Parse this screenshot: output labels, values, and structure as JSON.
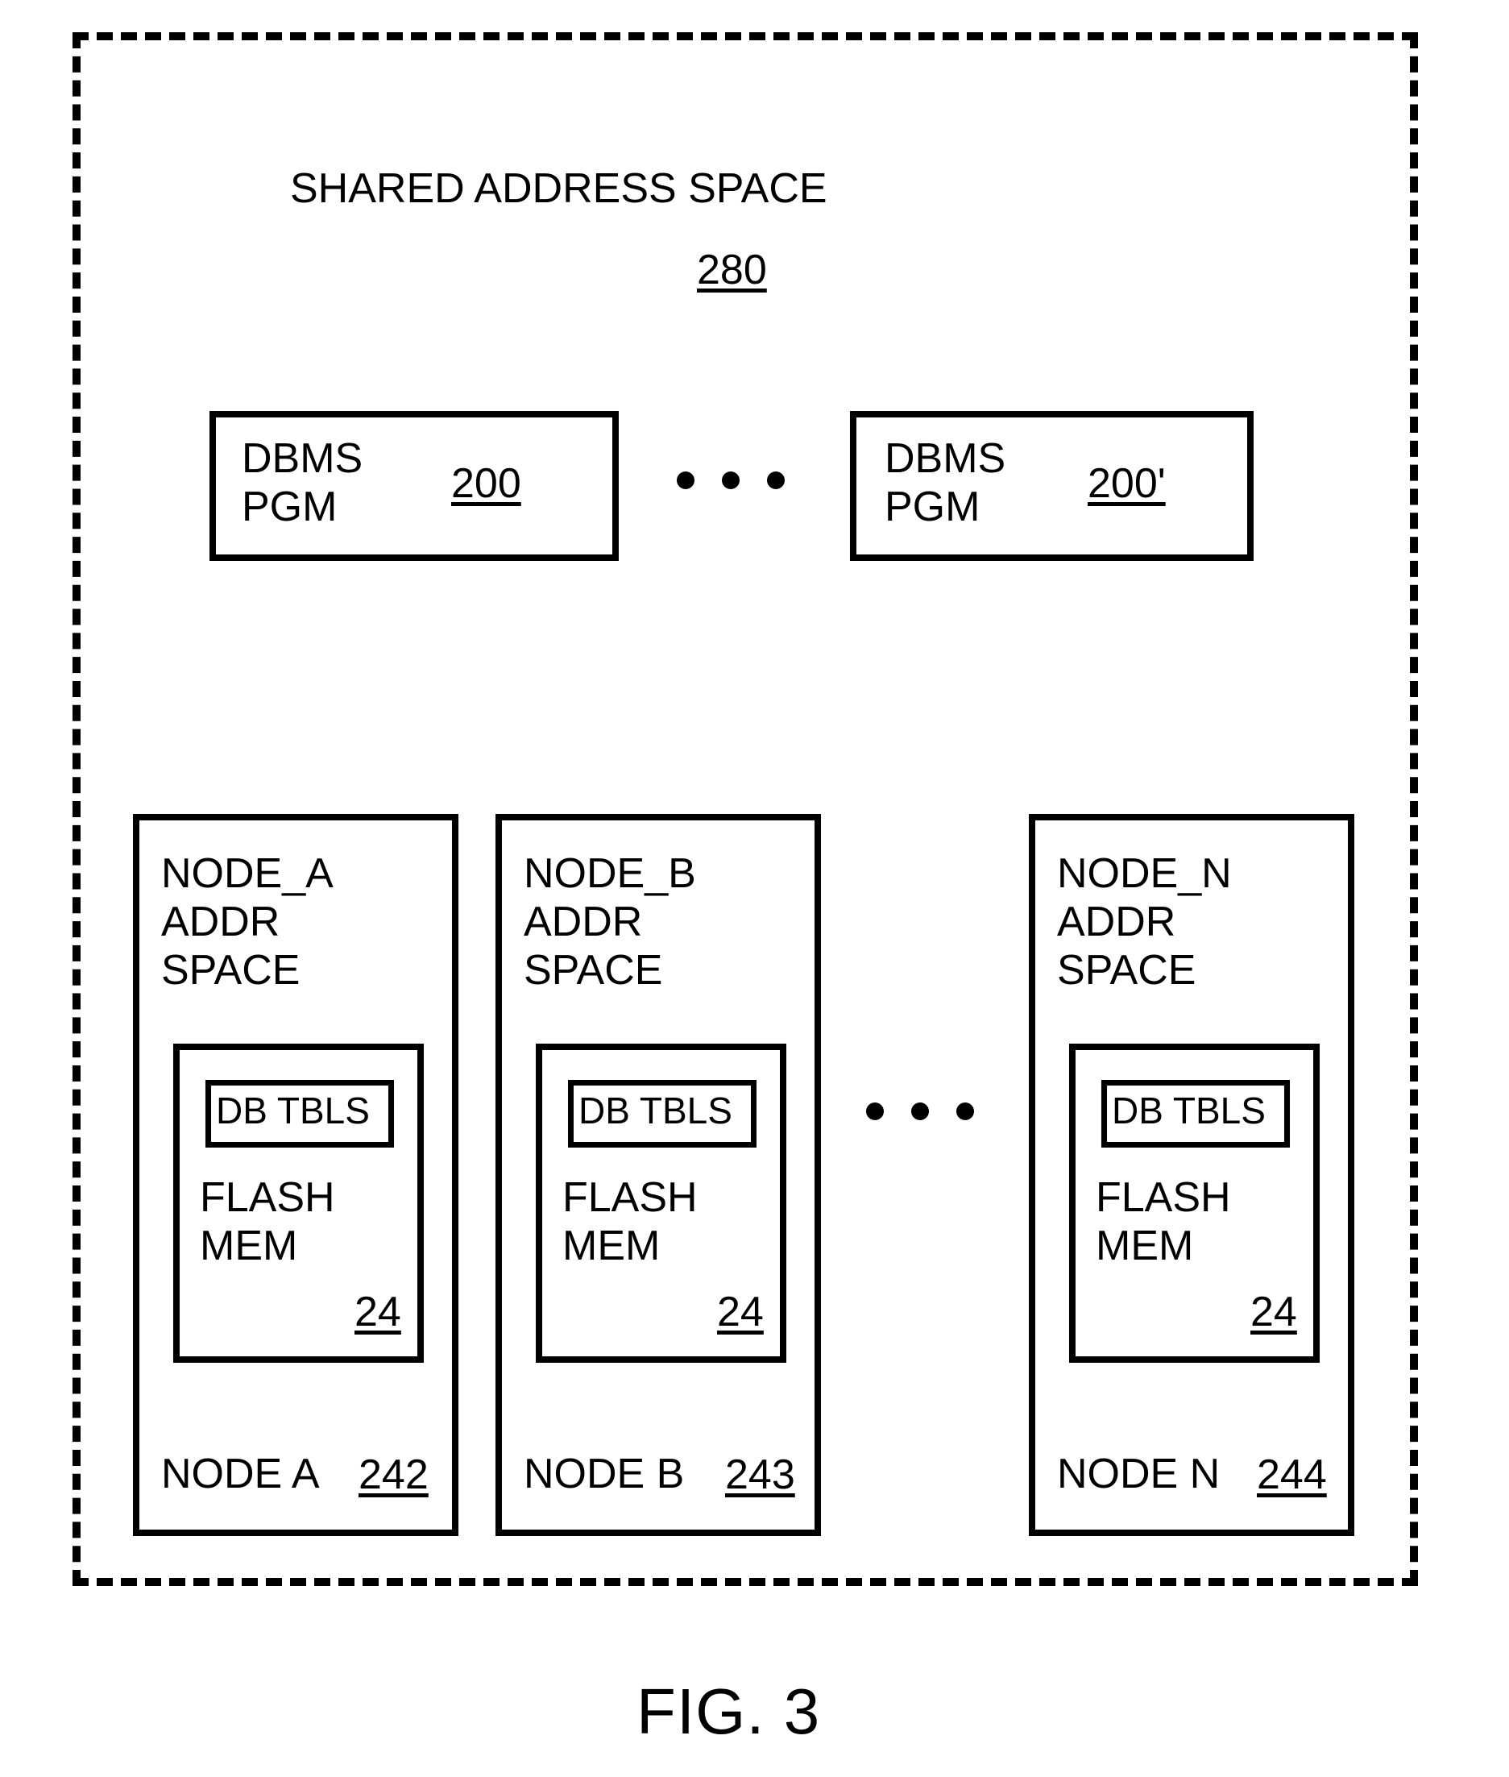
{
  "title": {
    "text": "SHARED ADDRESS SPACE",
    "ref": "280"
  },
  "pgm_row": {
    "left": {
      "label": "DBMS\nPGM",
      "ref": "200"
    },
    "right": {
      "label": "DBMS\nPGM",
      "ref": "200'"
    }
  },
  "nodes": {
    "a": {
      "title": "NODE_A\nADDR\nSPACE",
      "dbtbls": "DB TBLS",
      "flash": "FLASH\nMEM",
      "flash_ref": "24",
      "footer_name": "NODE A",
      "footer_ref": "242"
    },
    "b": {
      "title": "NODE_B\nADDR\nSPACE",
      "dbtbls": "DB TBLS",
      "flash": "FLASH\nMEM",
      "flash_ref": "24",
      "footer_name": "NODE B",
      "footer_ref": "243"
    },
    "n": {
      "title": "NODE_N\nADDR\nSPACE",
      "dbtbls": "DB TBLS",
      "flash": "FLASH\nMEM",
      "flash_ref": "24",
      "footer_name": "NODE N",
      "footer_ref": "244"
    }
  },
  "figure_label": "FIG. 3"
}
